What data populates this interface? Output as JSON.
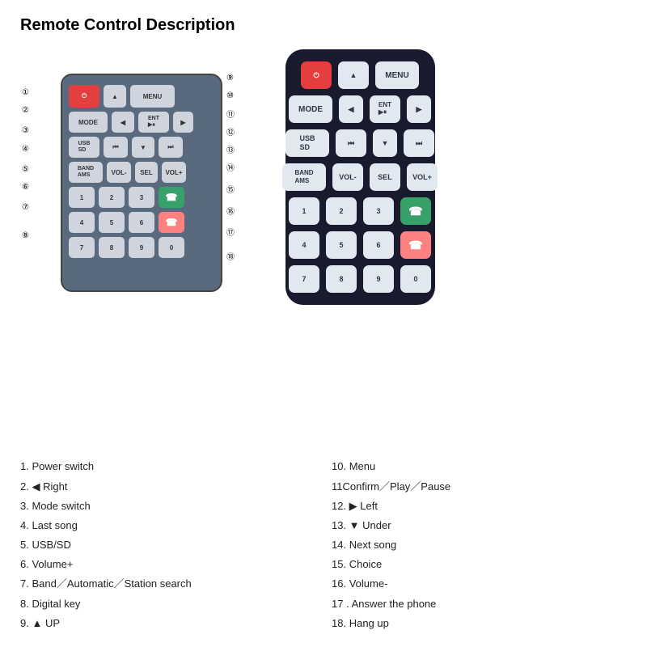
{
  "title": "Remote Control Description",
  "diagram": {
    "buttons": [
      {
        "label": "⏻",
        "type": "red"
      },
      {
        "label": "▲",
        "type": "normal"
      },
      {
        "label": "MENU",
        "type": "normal"
      },
      {
        "label": "MODE",
        "type": "normal"
      },
      {
        "label": "◀",
        "type": "normal"
      },
      {
        "label": "ENT\n▶⏸",
        "type": "normal"
      },
      {
        "label": "▶",
        "type": "normal"
      },
      {
        "label": "USB\nSD",
        "type": "normal"
      },
      {
        "label": "⏮",
        "type": "normal"
      },
      {
        "label": "▼",
        "type": "normal"
      },
      {
        "label": "⏭",
        "type": "normal"
      },
      {
        "label": "BAND\nAMS",
        "type": "normal"
      },
      {
        "label": "VOL-",
        "type": "normal"
      },
      {
        "label": "SEL",
        "type": "normal"
      },
      {
        "label": "VOL+",
        "type": "normal"
      },
      {
        "label": "1",
        "type": "normal"
      },
      {
        "label": "2",
        "type": "normal"
      },
      {
        "label": "3",
        "type": "normal"
      },
      {
        "label": "☎",
        "type": "green"
      },
      {
        "label": "4",
        "type": "normal"
      },
      {
        "label": "5",
        "type": "normal"
      },
      {
        "label": "6",
        "type": "normal"
      },
      {
        "label": "☎",
        "type": "pink"
      },
      {
        "label": "7",
        "type": "normal"
      },
      {
        "label": "8",
        "type": "normal"
      },
      {
        "label": "9",
        "type": "normal"
      },
      {
        "label": "0",
        "type": "normal"
      }
    ]
  },
  "callouts": [
    {
      "n": "①",
      "label": ""
    },
    {
      "n": "②",
      "label": ""
    },
    {
      "n": "③",
      "label": ""
    },
    {
      "n": "④",
      "label": ""
    },
    {
      "n": "⑤",
      "label": ""
    },
    {
      "n": "⑥",
      "label": ""
    },
    {
      "n": "⑦",
      "label": ""
    },
    {
      "n": "⑧",
      "label": ""
    },
    {
      "n": "⑨",
      "label": ""
    },
    {
      "n": "⑩",
      "label": ""
    },
    {
      "n": "⑪",
      "label": ""
    },
    {
      "n": "⑫",
      "label": ""
    },
    {
      "n": "⑬",
      "label": ""
    },
    {
      "n": "⑭",
      "label": ""
    },
    {
      "n": "⑮",
      "label": ""
    },
    {
      "n": "⑯",
      "label": ""
    },
    {
      "n": "⑰",
      "label": ""
    },
    {
      "n": "⑱",
      "label": ""
    }
  ],
  "descriptions_left": [
    {
      "num": "1.",
      "text": "Power switch"
    },
    {
      "num": "2. ◀",
      "text": "Right"
    },
    {
      "num": "3.",
      "text": "Mode switch"
    },
    {
      "num": "4.",
      "text": "Last song"
    },
    {
      "num": "5.",
      "text": "USB/SD"
    },
    {
      "num": "6.",
      "text": "Volume+"
    },
    {
      "num": "7.",
      "text": "Band／Automatic／Station search"
    },
    {
      "num": "8.",
      "text": "Digital key"
    },
    {
      "num": "9. ▲",
      "text": "UP"
    }
  ],
  "descriptions_right": [
    {
      "num": "10.",
      "text": "Menu"
    },
    {
      "num": "11",
      "text": "Confirm／Play／Pause"
    },
    {
      "num": "12. ▶",
      "text": "Left"
    },
    {
      "num": "13. ▼",
      "text": "Under"
    },
    {
      "num": "14.",
      "text": "Next song"
    },
    {
      "num": "15.",
      "text": "Choice"
    },
    {
      "num": "16.",
      "text": "Volume-"
    },
    {
      "num": "17 .",
      "text": "Answer the phone"
    },
    {
      "num": "18.",
      "text": "Hang up"
    }
  ]
}
